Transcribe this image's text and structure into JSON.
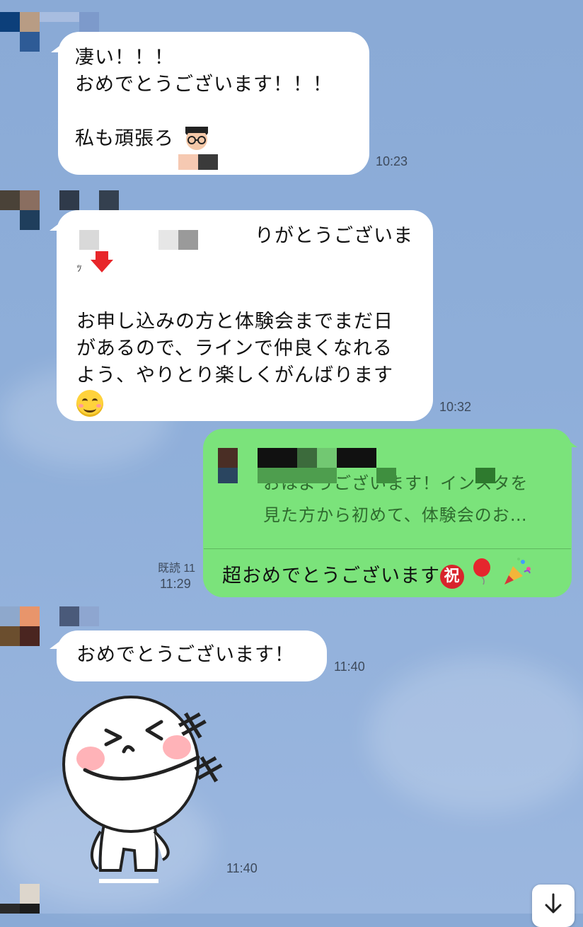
{
  "messages": [
    {
      "lines": [
        "凄い！！！",
        "おめでとうございます！！！",
        "",
        "私も頑張ろ"
      ],
      "time": "10:23"
    },
    {
      "lines": [
        "ありがとうございま",
        "す",
        "",
        "お申し込みの方と体験会までまだ日",
        "があるので、ラインで仲良くなれる",
        "よう、やりとり楽しくがんばります"
      ],
      "time": "10:32",
      "visible_partial": "りがとうございま"
    },
    {
      "quote_lines": [
        "おはようございます！インスタを",
        "見た方から初めて、体験会のお…"
      ],
      "body": "超おめでとうございます",
      "read_label": "既読 11",
      "time": "11:29"
    },
    {
      "text": "おめでとうございます！",
      "time": "11:40"
    },
    {
      "sticker": "smiling-character-sticker",
      "sticker_text": "キキ",
      "time": "11:40"
    }
  ],
  "colors": {
    "background": "#8eaed9",
    "incoming_bubble": "#ffffff",
    "outgoing_bubble": "#7be37b"
  },
  "icons": [
    "scroll-down-arrow-icon",
    "red-down-arrow-emoji",
    "smiling-face-emoji",
    "celebration-iwai-emoji",
    "balloon-emoji",
    "party-popper-emoji",
    "glasses-man-emoji"
  ]
}
